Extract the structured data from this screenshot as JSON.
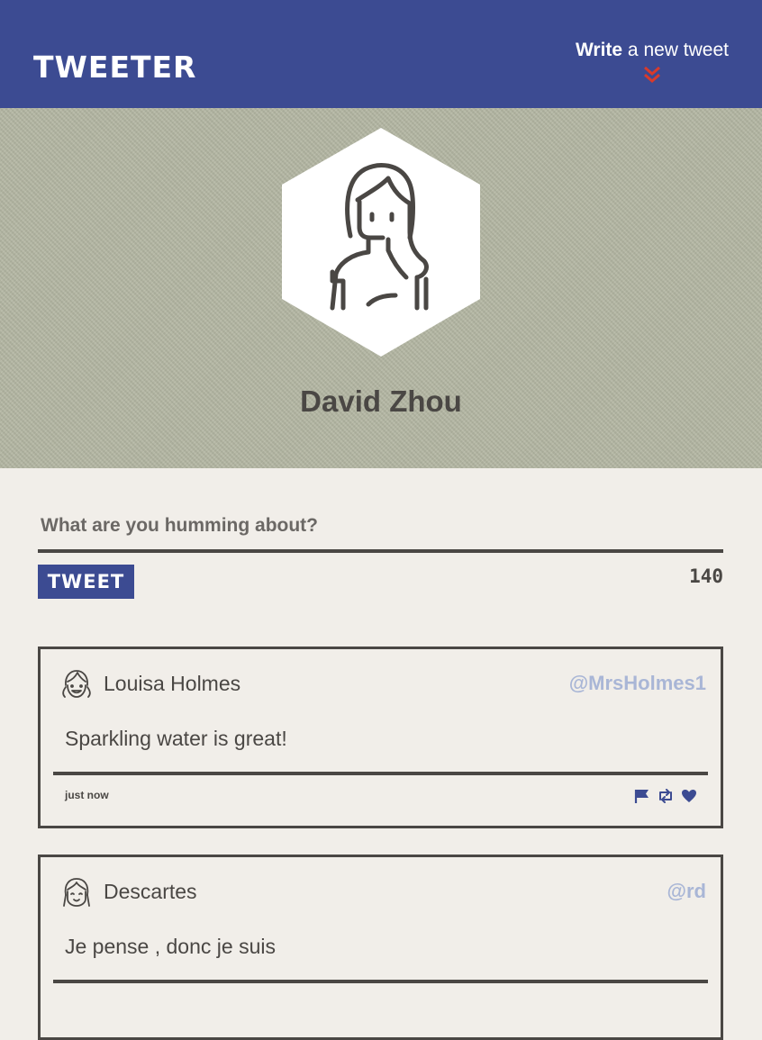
{
  "nav": {
    "brand": "TWEETER",
    "compose_strong": "Write",
    "compose_rest": " a new tweet"
  },
  "profile": {
    "name": "David Zhou"
  },
  "composer": {
    "placeholder": "What are you humming about?",
    "button_label": "TWEET",
    "counter": "140"
  },
  "tweets": [
    {
      "name": "Louisa Holmes",
      "handle": "@MrsHolmes1",
      "body": "Sparkling water is great!",
      "time": "just now"
    },
    {
      "name": "Descartes",
      "handle": "@rd",
      "body": "Je pense , donc je suis",
      "time": ""
    }
  ],
  "colors": {
    "nav": "#3c4b92",
    "accent_red": "#d93a2b",
    "handle": "#a9b6d6",
    "text": "#4a4744",
    "background": "#f1eee9"
  },
  "icons": [
    "chevrons-down-icon",
    "flag-icon",
    "retweet-icon",
    "heart-icon"
  ]
}
